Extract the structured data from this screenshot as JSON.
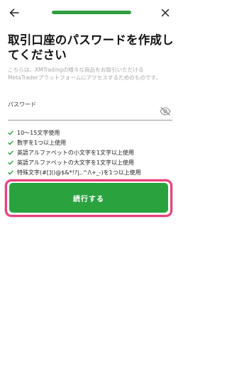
{
  "header": {
    "back_icon": "arrow-left-icon",
    "close_icon": "close-icon",
    "progress": 1.0,
    "accent_color": "#2e9e3e"
  },
  "main": {
    "title": "取引口座のパスワードを作成してください",
    "description": "こちらは、XMTradingの様々な商品をお取引いただけるMetaTraderプラットフォームにアクセスするためのものです。",
    "password_field": {
      "label": "パスワード",
      "value": "",
      "toggle_icon": "eye-off-icon"
    },
    "requirements": [
      "10〜15文字使用",
      "数字を1つ以上使用",
      "英語アルファベットの小文字を1文字以上使用",
      "英語アルファベットの大文字を1文字以上使用",
      "特殊文字(#[]()@$&*!?|,.^/\\+_-)を1つ以上使用"
    ],
    "continue_button": {
      "label": "続行する",
      "color": "#2aa33f",
      "highlight_color": "#e8417a"
    }
  }
}
